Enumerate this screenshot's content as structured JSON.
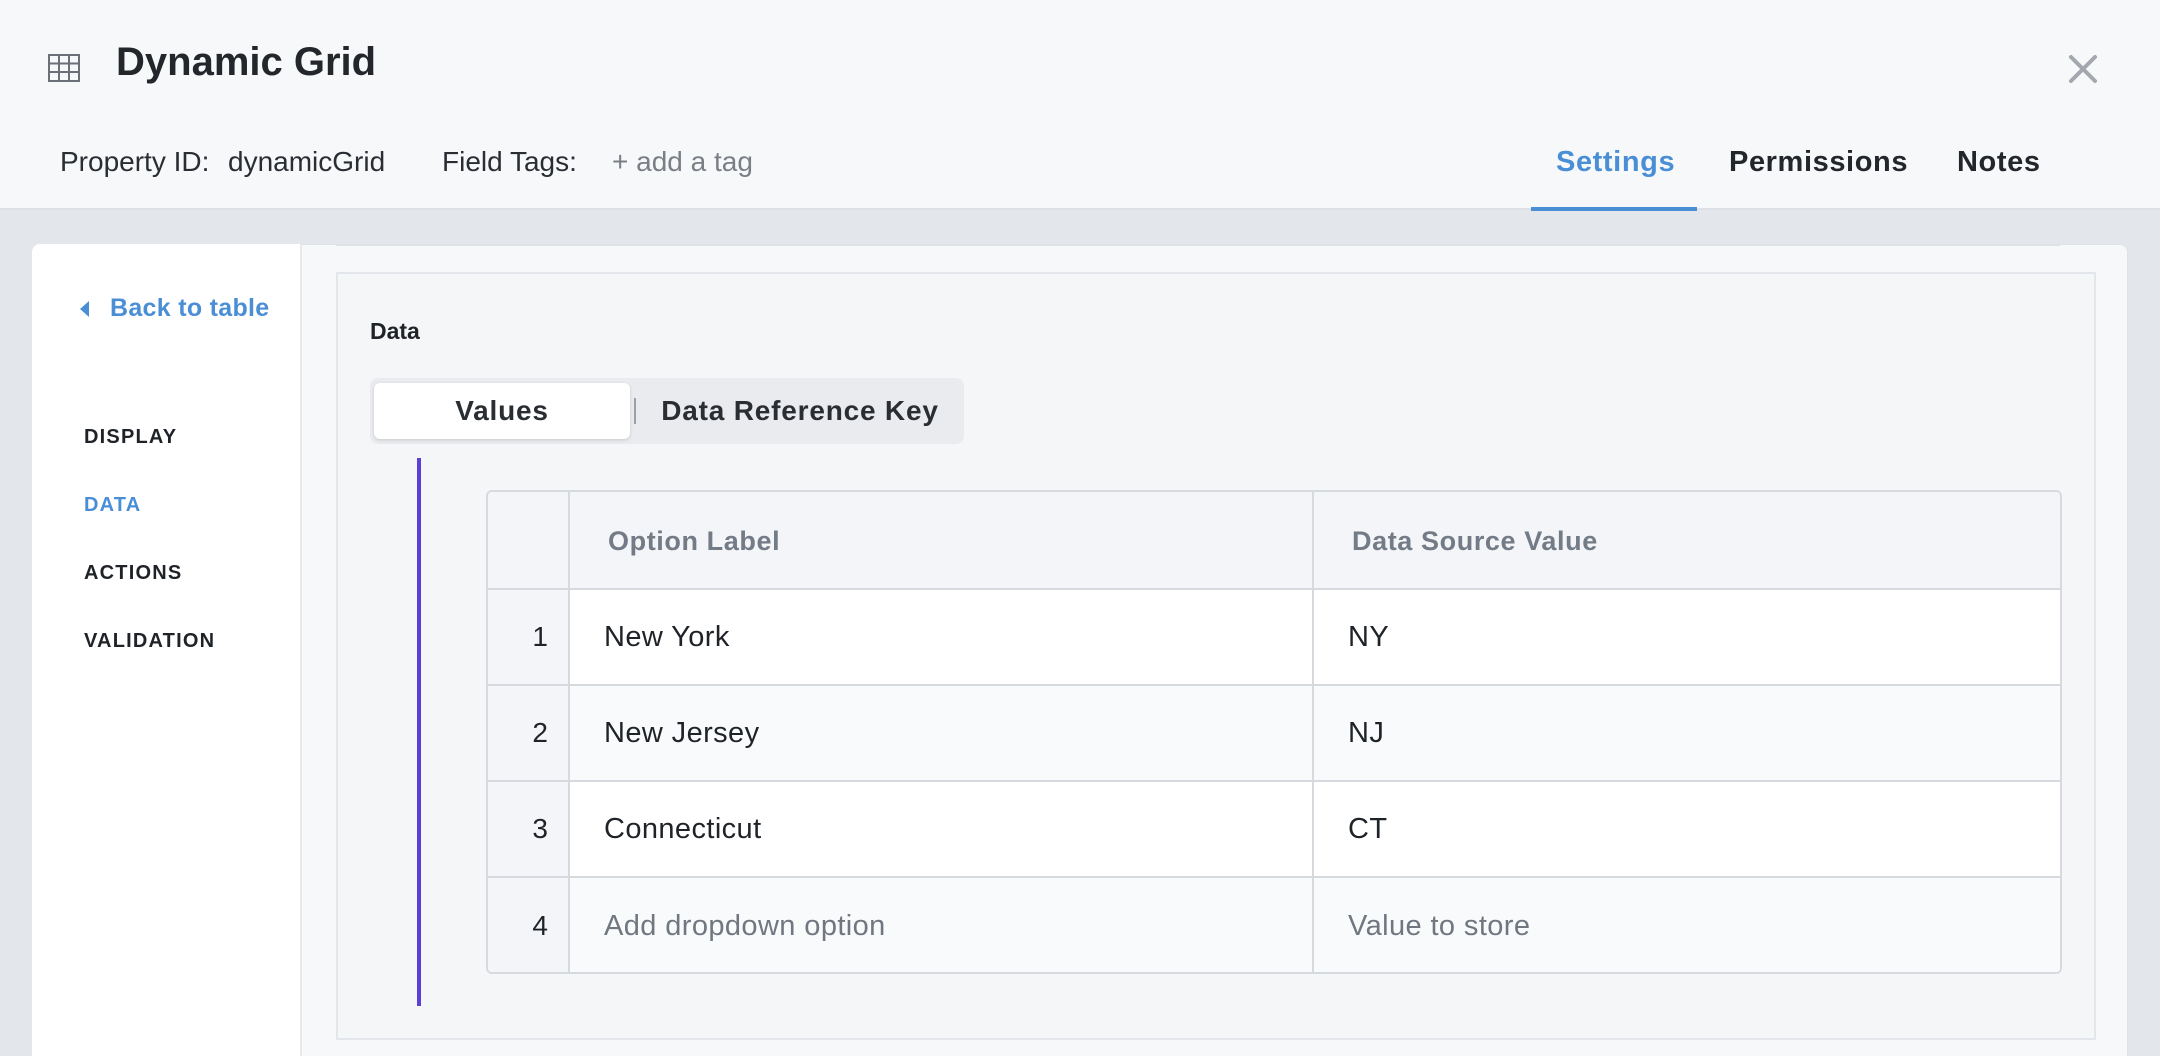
{
  "header": {
    "title": "Dynamic Grid",
    "title_icon": "grid-table-icon",
    "property_id_label": "Property ID:",
    "property_id_value": "dynamicGrid",
    "field_tags_label": "Field Tags:",
    "add_tag_label": "+ add a tag",
    "tabs": [
      {
        "label": "Settings",
        "active": true
      },
      {
        "label": "Permissions",
        "active": false
      },
      {
        "label": "Notes",
        "active": false
      }
    ],
    "accent_color": "#4a8fd6"
  },
  "sidebar": {
    "back_label": "Back to table",
    "items": [
      {
        "label": "DISPLAY",
        "active": false
      },
      {
        "label": "DATA",
        "active": true
      },
      {
        "label": "ACTIONS",
        "active": false
      },
      {
        "label": "VALIDATION",
        "active": false
      }
    ]
  },
  "main": {
    "section_title": "Data",
    "segments": [
      {
        "label": "Values",
        "active": true
      },
      {
        "label": "Data Reference Key",
        "active": false
      }
    ],
    "table": {
      "columns": [
        "Option Label",
        "Data Source Value"
      ],
      "rows": [
        {
          "index": "1",
          "label": "New York",
          "value": "NY",
          "placeholder": false
        },
        {
          "index": "2",
          "label": "New Jersey",
          "value": "NJ",
          "placeholder": false
        },
        {
          "index": "3",
          "label": "Connecticut",
          "value": "CT",
          "placeholder": false
        },
        {
          "index": "4",
          "label": "Add dropdown option",
          "value": "Value to store",
          "placeholder": true
        }
      ]
    },
    "accent_bar_color": "#5b3fd6"
  }
}
